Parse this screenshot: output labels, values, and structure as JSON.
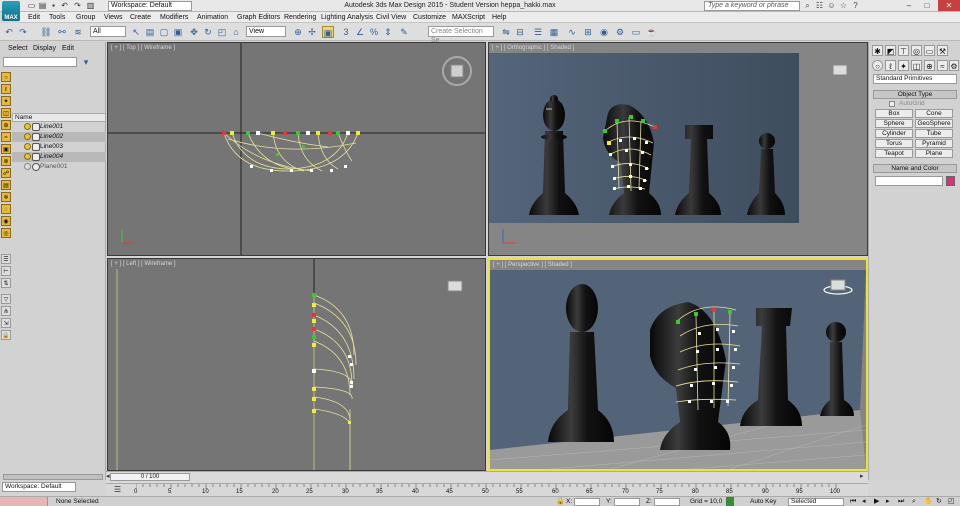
{
  "titlebar": {
    "logo": "MAX",
    "workspace": "Workspace: Default",
    "app_title": "Autodesk 3ds Max Design 2015 - Student Version   heppa_hakki.max",
    "search_placeholder": "Type a keyword or phrase",
    "minimize": "–",
    "maximize": "□",
    "close": "✕"
  },
  "menubar": {
    "items": [
      "Edit",
      "Tools",
      "Group",
      "Views",
      "Create",
      "Modifiers",
      "Animation",
      "Graph Editors",
      "Rendering",
      "Lighting Analysis",
      "Civil View",
      "Customize",
      "MAXScript",
      "Help"
    ]
  },
  "toolbar": {
    "selection_filter": "All",
    "ref_coord": "View",
    "named_selection": "Create Selection Se"
  },
  "scene_explorer": {
    "tabs": [
      "Select",
      "Display",
      "Edit"
    ],
    "column_header": "Name",
    "objects": [
      {
        "name": "Line001",
        "selected": false,
        "type": "shape"
      },
      {
        "name": "Line002",
        "selected": true,
        "type": "shape"
      },
      {
        "name": "Line003",
        "selected": false,
        "type": "shape"
      },
      {
        "name": "Line004",
        "selected": true,
        "type": "shape"
      },
      {
        "name": "Plane001",
        "selected": false,
        "type": "plane"
      }
    ],
    "workspace_bottom": "Workspace: Default"
  },
  "viewports": {
    "top": "[ + ] [ Top ] [ Wireframe ]",
    "ortho": "[ + ] [ Orthographic ] [ Shaded ]",
    "left": "[ + ] [ Left ] [ Wireframe ]",
    "persp": "[ + ] [ Perspective ] [ Shaded ]"
  },
  "command_panel": {
    "category": "Standard Primitives",
    "object_type": "Object Type",
    "autogrid": "AutoGrid",
    "buttons": [
      "Box",
      "Cone",
      "Sphere",
      "GeoSphere",
      "Cylinder",
      "Tube",
      "Torus",
      "Pyramid",
      "Teapot",
      "Plane"
    ],
    "name_and_color": "Name and Color",
    "color": "#d6337a"
  },
  "timeline": {
    "slider": "0 / 100",
    "ticks": [
      "0",
      "5",
      "10",
      "15",
      "20",
      "25",
      "30",
      "35",
      "40",
      "45",
      "50",
      "55",
      "60",
      "65",
      "70",
      "75",
      "80",
      "85",
      "90",
      "95",
      "100"
    ]
  },
  "status": {
    "selection": "None Selected",
    "x_label": "X:",
    "y_label": "Y:",
    "z_label": "Z:",
    "grid": "Grid = 10,0",
    "auto_key": "Auto Key",
    "selected": "Selected"
  }
}
